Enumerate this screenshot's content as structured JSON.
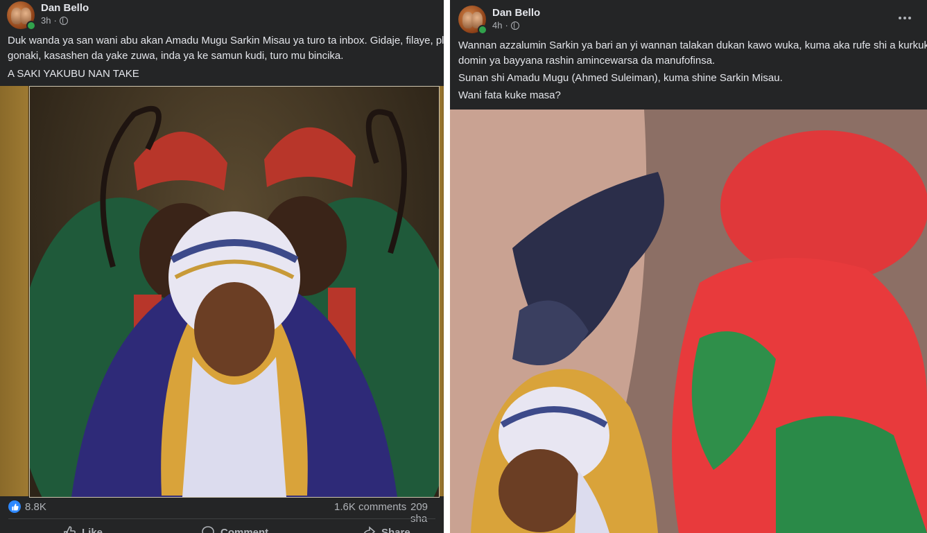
{
  "left_post": {
    "author": "Dan Bello",
    "time": "3h",
    "visibility_icon": "globe-icon",
    "body_line1": "Duk wanda ya san wani abu akan Amadu Mugu Sarkin Misau ya turo ta inbox. Gidaje, filaye, plaza,",
    "body_line2": "gonaki, kasashen da yake zuwa, inda ya ke samun kudi, turo mu bincika.",
    "body_line3": "A SAKI YAKUBU NAN TAKE",
    "reactions": "8.8K",
    "comments": "1.6K comments",
    "shares": "209 sha",
    "actions": {
      "like": "Like",
      "comment": "Comment",
      "share": "Share"
    }
  },
  "right_post": {
    "author": "Dan Bello",
    "time": "4h",
    "visibility_icon": "globe-icon",
    "body_line1": "Wannan azzalumin Sarkin ya bari an yi wannan talakan dukan kawo wuka, kuma aka rufe shi a kurkuku",
    "body_line2": "domin ya bayyana rashin amincewarsa da manufofinsa.",
    "body_line3": "Sunan shi Amadu Mugu (Ahmed Suleiman), kuma shine Sarkin Misau.",
    "body_line4": "Wani fata kuke masa?",
    "more_icon": "more-options-icon"
  },
  "colors": {
    "card_bg": "#242526",
    "text_primary": "#e4e6eb",
    "text_secondary": "#b0b3b8",
    "online": "#31a24c",
    "like_blue": "#2d88ff"
  }
}
